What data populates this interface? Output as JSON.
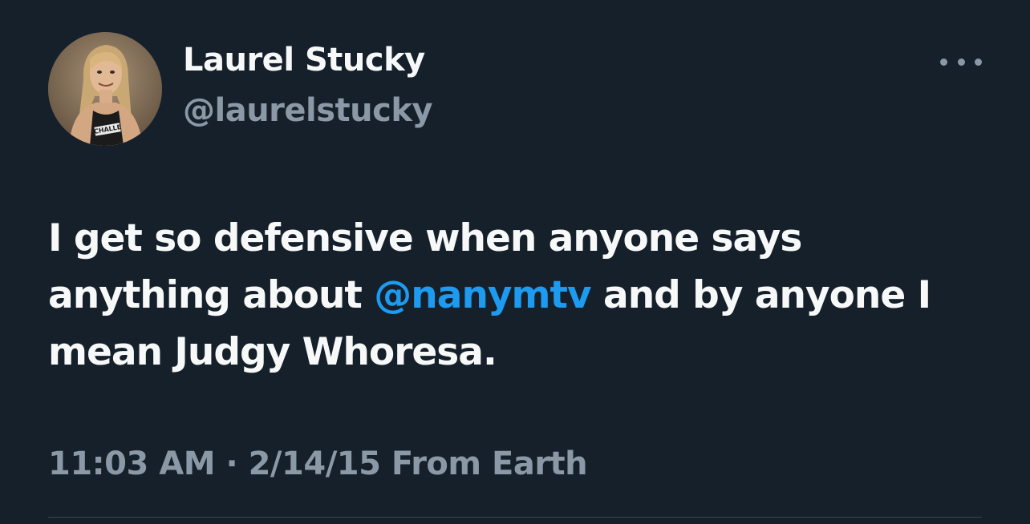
{
  "tweet": {
    "display_name": "Laurel Stucky",
    "handle": "@laurelstucky",
    "text_before": "I get so defensive when anyone says anything about ",
    "mention": "@nanymtv",
    "text_after": " and by anyone I mean Judgy Whoresa.",
    "time": "11:03 AM",
    "separator": "·",
    "date": "2/14/15",
    "source": "From Earth",
    "more_icon": "ellipsis-icon",
    "avatar_text": "CHALLE"
  },
  "colors": {
    "background": "#15202b",
    "text_primary": "#f7f9f9",
    "text_secondary": "#8b98a5",
    "accent": "#1d9bf0",
    "divider": "#38444d"
  }
}
